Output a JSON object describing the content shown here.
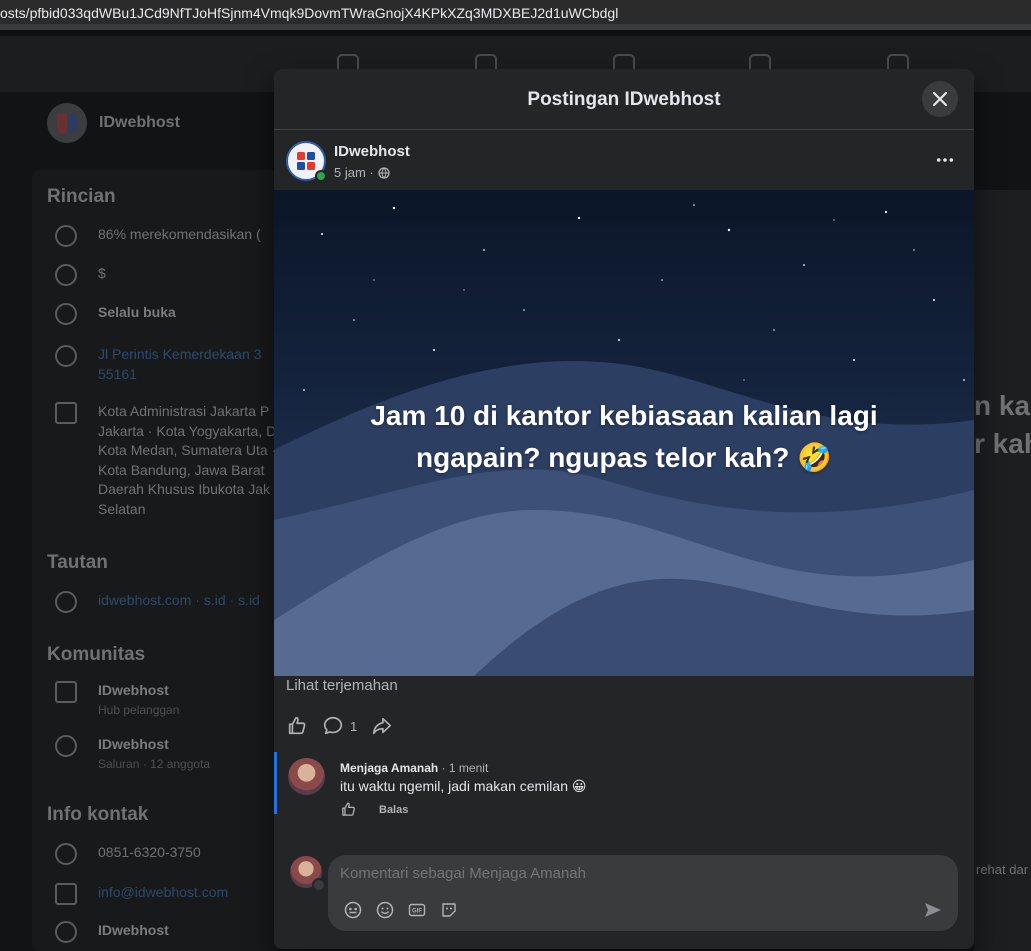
{
  "browser": {
    "url": "osts/pfbid033qdWBu1JCd9NfTJoHfSjnm4Vmqk9DovmTWraGnojX4KPkXZq3MDXBEJ2d1uWCbdgl"
  },
  "background": {
    "page_name": "IDwebhost",
    "sections": {
      "details_title": "Rincian",
      "recommend": "86% merekomendasikan (",
      "price": "$",
      "hours": "Selalu buka",
      "address": "Jl Perintis Kemerdekaan 3",
      "address_zip": "55161",
      "areas": "Kota Administrasi Jakarta P Jakarta · Kota Yogyakarta, D Kota Medan, Sumatera Uta · Kota Bandung, Jawa Barat Daerah Khusus Ibukota Jak Selatan",
      "links_title": "Tautan",
      "links": "idwebhost.com · s.id · s.id",
      "community_title": "Komunitas",
      "community1_name": "IDwebhost",
      "community1_sub": "Hub pelanggan",
      "community2_name": "IDwebhost",
      "community2_sub": "Saluran · 12 anggota",
      "contact_title": "Info kontak",
      "phone": "0851-6320-3750",
      "email": "info@idwebhost.com",
      "messenger": "IDwebhost"
    },
    "right_snippet_1": "n ka",
    "right_snippet_2": "r kah",
    "right_snippet_3": "rehat dar"
  },
  "modal": {
    "title": "Postingan IDwebhost",
    "post": {
      "author": "IDwebhost",
      "time": "5 jam ·",
      "image_text": "Jam 10 di kantor kebiasaan kalian lagi ngapain? ngupas telor kah? 🤣",
      "translate_label": "Lihat terjemahan",
      "comment_count": "1"
    },
    "comment": {
      "author": "Menjaga Amanah",
      "time": "· 1 menit",
      "text": "itu waktu ngemil, jadi makan cemilan 😀",
      "reply_label": "Balas"
    },
    "composer": {
      "placeholder": "Komentari sebagai Menjaga Amanah"
    }
  },
  "colors": {
    "accent": "#2374e1",
    "online": "#31a24c",
    "surface": "#242526"
  }
}
